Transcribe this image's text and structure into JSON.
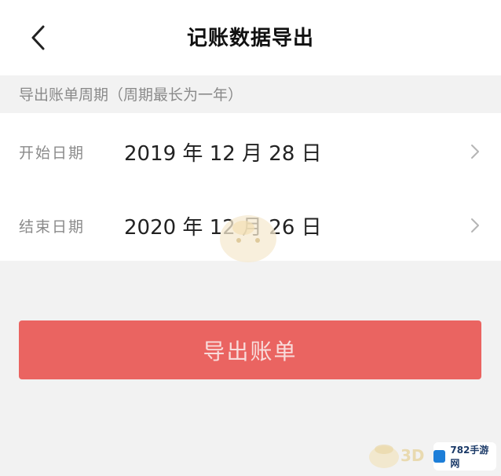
{
  "header": {
    "title": "记账数据导出",
    "back_icon": "chevron-left-icon"
  },
  "section": {
    "title": "导出账单周期（周期最长为一年）"
  },
  "rows": [
    {
      "label": "开始日期",
      "value": "2019 年 12 月 28 日",
      "icon": "chevron-right-icon"
    },
    {
      "label": "结束日期",
      "value": "2020 年 12 月 26 日",
      "icon": "chevron-right-icon"
    }
  ],
  "export_button": {
    "label": "导出账单"
  },
  "watermark": {
    "site_text": "782手游网",
    "logo_text": "3D"
  },
  "colors": {
    "primary_button": "#ea6461",
    "button_text": "#f8dcdb",
    "background": "#f2f2f2",
    "panel": "#ffffff",
    "muted_text": "#8a8a8a"
  }
}
